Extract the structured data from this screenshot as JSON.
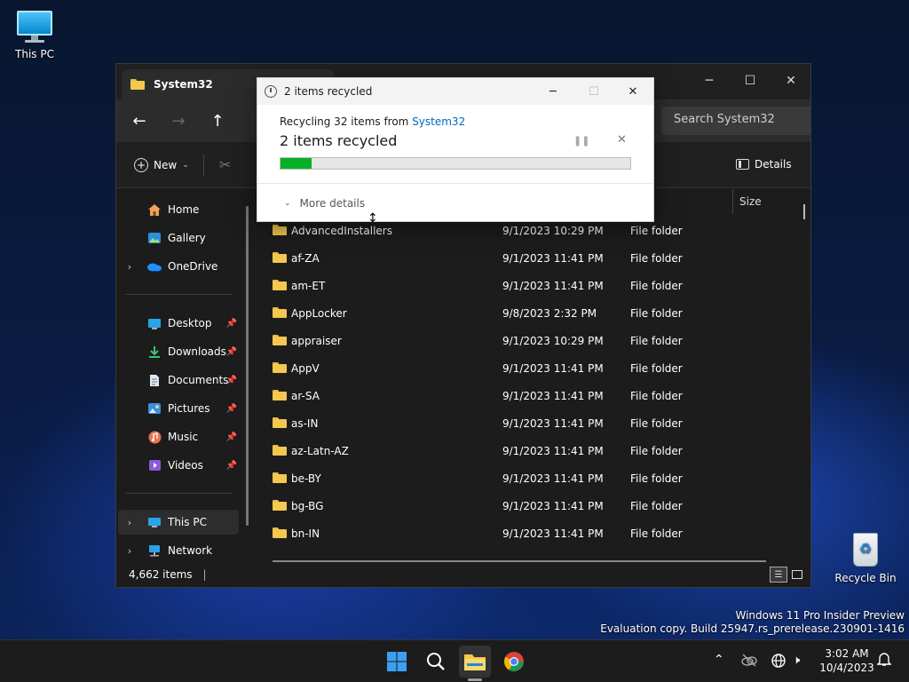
{
  "desktop": {
    "this_pc_label": "This PC",
    "recycle_bin_label": "Recycle Bin",
    "watermark_line1": "Windows 11 Pro Insider Preview",
    "watermark_line2": "Evaluation copy. Build 25947.rs_prerelease.230901-1416"
  },
  "explorer": {
    "tab_title": "System32",
    "search_placeholder": "Search System32",
    "new_label": "New",
    "details_label": "Details",
    "column_size": "Size",
    "status_items": "4,662 items",
    "sidebar": [
      {
        "label": "Home",
        "icon": "home-icon"
      },
      {
        "label": "Gallery",
        "icon": "gallery-icon"
      },
      {
        "label": "OneDrive",
        "icon": "cloud-icon"
      },
      {
        "label": "Desktop",
        "icon": "desktop-icon"
      },
      {
        "label": "Downloads",
        "icon": "download-icon"
      },
      {
        "label": "Documents",
        "icon": "documents-icon"
      },
      {
        "label": "Pictures",
        "icon": "pictures-icon"
      },
      {
        "label": "Music",
        "icon": "music-icon"
      },
      {
        "label": "Videos",
        "icon": "videos-icon"
      },
      {
        "label": "This PC",
        "icon": "computer-icon"
      },
      {
        "label": "Network",
        "icon": "network-icon"
      }
    ],
    "files": [
      {
        "name": "AdvancedInstallers",
        "date": "9/1/2023 10:29 PM",
        "type": "File folder"
      },
      {
        "name": "af-ZA",
        "date": "9/1/2023 11:41 PM",
        "type": "File folder"
      },
      {
        "name": "am-ET",
        "date": "9/1/2023 11:41 PM",
        "type": "File folder"
      },
      {
        "name": "AppLocker",
        "date": "9/8/2023 2:32 PM",
        "type": "File folder"
      },
      {
        "name": "appraiser",
        "date": "9/1/2023 10:29 PM",
        "type": "File folder"
      },
      {
        "name": "AppV",
        "date": "9/1/2023 11:41 PM",
        "type": "File folder"
      },
      {
        "name": "ar-SA",
        "date": "9/1/2023 11:41 PM",
        "type": "File folder"
      },
      {
        "name": "as-IN",
        "date": "9/1/2023 11:41 PM",
        "type": "File folder"
      },
      {
        "name": "az-Latn-AZ",
        "date": "9/1/2023 11:41 PM",
        "type": "File folder"
      },
      {
        "name": "be-BY",
        "date": "9/1/2023 11:41 PM",
        "type": "File folder"
      },
      {
        "name": "bg-BG",
        "date": "9/1/2023 11:41 PM",
        "type": "File folder"
      },
      {
        "name": "bn-IN",
        "date": "9/1/2023 11:41 PM",
        "type": "File folder"
      }
    ]
  },
  "dialog": {
    "title": "2 items recycled",
    "subtitle_prefix": "Recycling 32 items from ",
    "subtitle_link": "System32",
    "heading": "2 items recycled",
    "more_details": "More details",
    "progress_fraction": 0.09
  },
  "taskbar": {
    "time": "3:02 AM",
    "date": "10/4/2023"
  },
  "colors": {
    "accent_green": "#06b025",
    "folder_yellow": "#f4c84e",
    "link_blue": "#0067c0"
  }
}
